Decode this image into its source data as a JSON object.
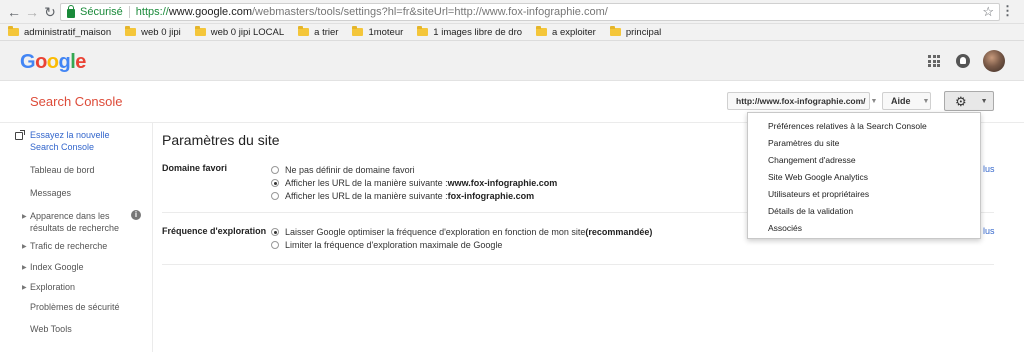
{
  "browser": {
    "secure_label": "Sécurisé",
    "url_proto": "https://",
    "url_host": "www.google.com",
    "url_path": "/webmasters/tools/settings?hl=fr&siteUrl=http://www.fox-infographie.com/"
  },
  "bookmarks": [
    "administratif_maison",
    "web 0 jipi",
    "web 0 jipi LOCAL",
    "a trier",
    "1moteur",
    "1 images libre de dro",
    "a exploiter",
    "principal"
  ],
  "google": {
    "logo": "Google"
  },
  "header": {
    "product_title": "Search Console",
    "site_selector": "http://www.fox-infographie.com/",
    "help_label": "Aide"
  },
  "sidebar": {
    "items": [
      {
        "label_line1": "Essayez la nouvelle",
        "label_line2": "Search Console"
      },
      {
        "label": "Tableau de bord"
      },
      {
        "label": "Messages"
      },
      {
        "label_line1": "Apparence dans les",
        "label_line2": "résultats de recherche"
      },
      {
        "label": "Trafic de recherche"
      },
      {
        "label": "Index Google"
      },
      {
        "label": "Exploration"
      },
      {
        "label": "Problèmes de sécurité"
      },
      {
        "label": "Web Tools"
      }
    ]
  },
  "main": {
    "title": "Paramètres du site",
    "preferred_domain": {
      "label": "Domaine favori",
      "options": [
        {
          "text": "Ne pas définir de domaine favori",
          "bold": "",
          "selected": false
        },
        {
          "text": "Afficher les URL de la manière suivante : ",
          "bold": "www.fox-infographie.com",
          "selected": true
        },
        {
          "text": "Afficher les URL de la manière suivante : ",
          "bold": "fox-infographie.com",
          "selected": false
        }
      ]
    },
    "crawl_rate": {
      "label": "Fréquence d'exploration",
      "options": [
        {
          "text": "Laisser Google optimiser la fréquence d'exploration en fonction de mon site ",
          "bold": "(recommandée)",
          "selected": true
        },
        {
          "text": "Limiter la fréquence d'exploration maximale de Google",
          "bold": "",
          "selected": false
        }
      ]
    },
    "more_links": [
      "lus",
      "lus"
    ]
  },
  "settings_menu": {
    "items": [
      "Préférences relatives à la Search Console",
      "Paramètres du site",
      "Changement d'adresse",
      "Site Web Google Analytics",
      "Utilisateurs et propriétaires",
      "Détails de la validation",
      "Associés"
    ]
  }
}
